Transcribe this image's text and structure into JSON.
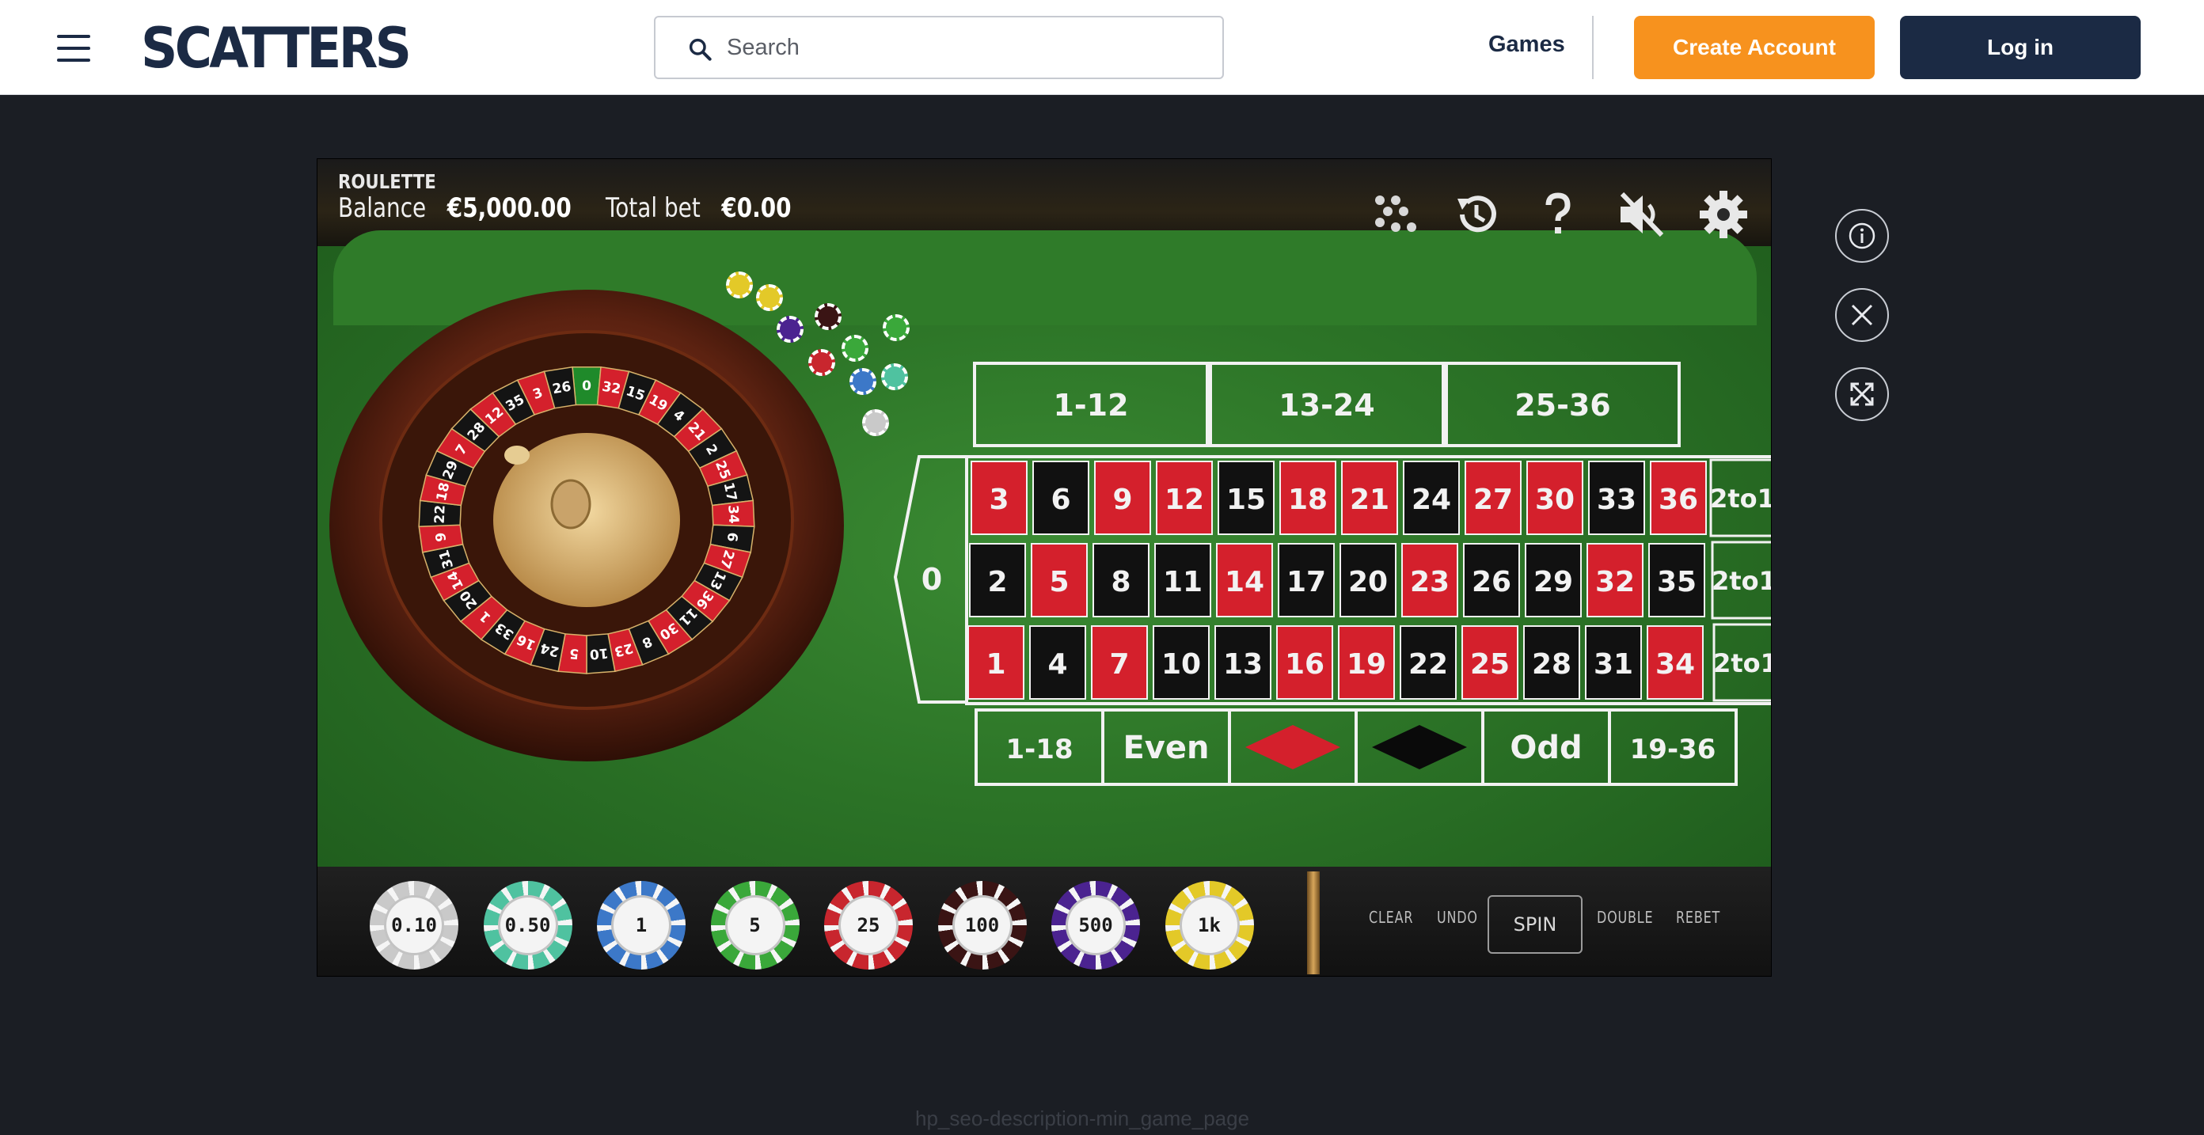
{
  "header": {
    "logo": "SCATTERS",
    "search_placeholder": "Search",
    "games_label": "Games",
    "create_account_label": "Create Account",
    "login_label": "Log in"
  },
  "game": {
    "title": "ROULETTE",
    "balance_label": "Balance",
    "balance_value": "€5,000.00",
    "total_bet_label": "Total bet",
    "total_bet_value": "€0.00",
    "hud_icons": [
      "chips-icon",
      "history-icon",
      "help-icon",
      "sound-muted-icon",
      "settings-icon"
    ],
    "table": {
      "dozens": [
        "1-12",
        "13-24",
        "25-36"
      ],
      "zero": "0",
      "columns_label": "2to1",
      "rows": [
        [
          "3",
          "6",
          "9",
          "12",
          "15",
          "18",
          "21",
          "24",
          "27",
          "30",
          "33",
          "36"
        ],
        [
          "2",
          "5",
          "8",
          "11",
          "14",
          "17",
          "20",
          "23",
          "26",
          "29",
          "32",
          "35"
        ],
        [
          "1",
          "4",
          "7",
          "10",
          "13",
          "16",
          "19",
          "22",
          "25",
          "28",
          "31",
          "34"
        ]
      ],
      "red_numbers": [
        1,
        3,
        5,
        7,
        9,
        12,
        14,
        16,
        18,
        19,
        21,
        23,
        25,
        27,
        30,
        32,
        34,
        36
      ],
      "outside": [
        "1-18",
        "Even",
        "red",
        "black",
        "Odd",
        "19-36"
      ]
    },
    "wheel_numbers": [
      "0",
      "32",
      "15",
      "19",
      "4",
      "21",
      "2",
      "25",
      "17",
      "34",
      "6",
      "27",
      "13",
      "36",
      "11",
      "30",
      "8",
      "23",
      "10",
      "5",
      "24",
      "16",
      "33",
      "1",
      "20",
      "14",
      "31",
      "9",
      "22",
      "18",
      "29",
      "7",
      "28",
      "12",
      "35",
      "3",
      "26"
    ],
    "chips": [
      {
        "label": "0.10",
        "color": "#c9c9c9"
      },
      {
        "label": "0.50",
        "color": "#4fc2a0"
      },
      {
        "label": "1",
        "color": "#3c78c8"
      },
      {
        "label": "5",
        "color": "#3aa83a"
      },
      {
        "label": "25",
        "color": "#c8262e"
      },
      {
        "label": "100",
        "color": "#3a1414"
      },
      {
        "label": "500",
        "color": "#4b2390"
      },
      {
        "label": "1k",
        "color": "#e3c928"
      }
    ],
    "controls": {
      "clear": "CLEAR",
      "undo": "UNDO",
      "spin": "SPIN",
      "double": "DOUBLE",
      "rebet": "REBET"
    }
  },
  "side_buttons": [
    "info-icon",
    "close-icon",
    "fullscreen-icon"
  ],
  "seo_text": "hp_seo-description-min_game_page",
  "colors": {
    "brand_navy": "#1b2a44",
    "brand_orange": "#f7921e",
    "felt_green": "#2c7427",
    "roulette_red": "#d4202c"
  }
}
